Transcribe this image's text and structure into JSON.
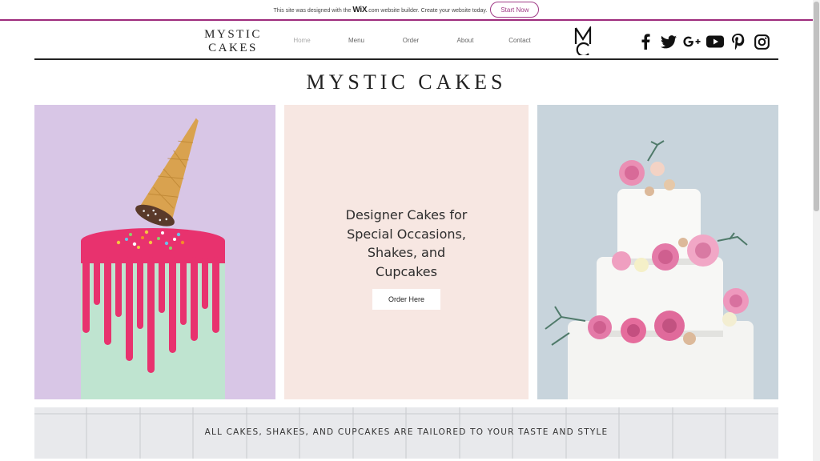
{
  "wix_banner": {
    "prefix": "This site was designed with the",
    "logo": "WiX",
    "suffix": ".com website builder. Create your website today.",
    "button": "Start Now"
  },
  "header": {
    "brand_line1": "MYSTIC",
    "brand_line2": "CAKES",
    "nav": [
      "Home",
      "Menu",
      "Order",
      "About",
      "Contact"
    ],
    "active_nav": "Home",
    "socials": [
      "facebook-icon",
      "twitter-icon",
      "google-plus-icon",
      "youtube-icon",
      "pinterest-icon",
      "instagram-icon"
    ]
  },
  "title": "MYSTIC CAKES",
  "hero": {
    "heading_lines": [
      "Designer Cakes for",
      "Special Occasions,",
      "Shakes, and",
      "Cupcakes"
    ],
    "button": "Order Here"
  },
  "tagline": "ALL CAKES, SHAKES, AND CUPCAKES ARE TAILORED TO YOUR TASTE AND STYLE",
  "colors": {
    "banner_accent": "#9e2b7c",
    "left_panel_bg": "#d8c6e6",
    "mid_panel_bg": "#f7e7e2",
    "right_panel_bg": "#c8d4dc",
    "drip_pink": "#e8326e",
    "cake_mint": "#bfe4d0"
  }
}
